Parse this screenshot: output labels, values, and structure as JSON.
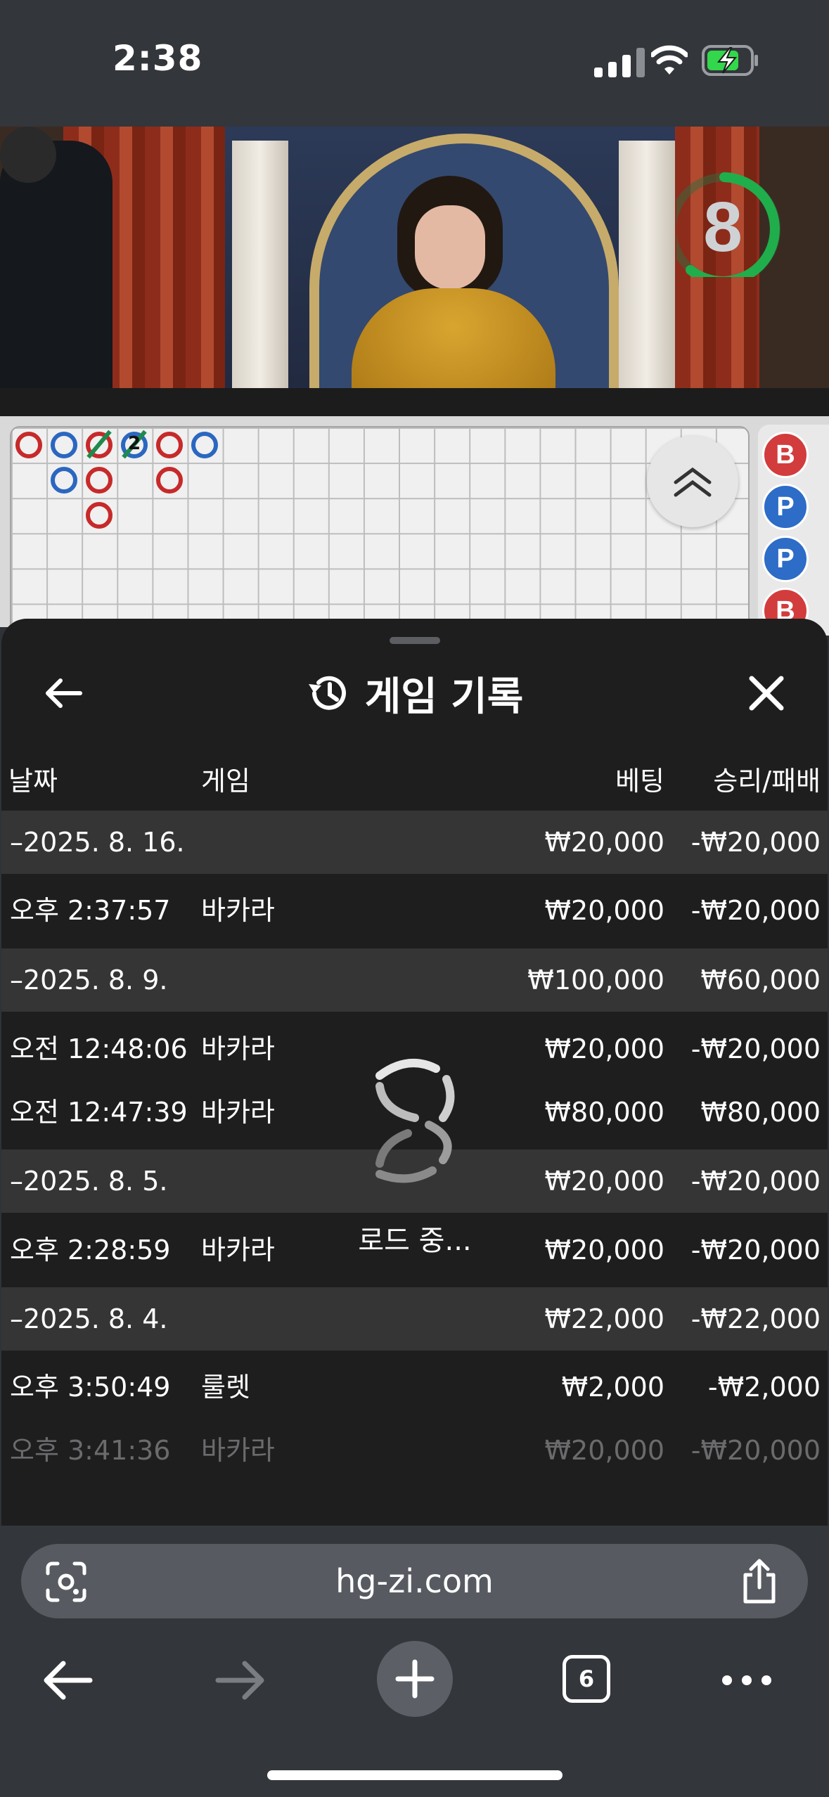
{
  "status_bar": {
    "time": "2:38"
  },
  "live_video": {
    "countdown": "8",
    "countdown_color": "#1fae4b"
  },
  "roadmap": {
    "tie_count": "2",
    "side_beads": [
      "B",
      "P",
      "P",
      "B"
    ]
  },
  "sheet": {
    "title": "게임 기록",
    "columns": {
      "date": "날짜",
      "game": "게임",
      "bet": "베팅",
      "result": "승리/패배"
    },
    "rows": [
      {
        "kind": "day",
        "date": "–2025. 8. 16.",
        "game": "",
        "bet": "₩20,000",
        "result": "-₩20,000"
      },
      {
        "kind": "game",
        "date": "오후 2:37:57",
        "game": "바카라",
        "bet": "₩20,000",
        "result": "-₩20,000"
      },
      {
        "kind": "day",
        "date": "–2025. 8. 9.",
        "game": "",
        "bet": "₩100,000",
        "result": "₩60,000"
      },
      {
        "kind": "game",
        "date": "오전 12:48:06",
        "game": "바카라",
        "bet": "₩20,000",
        "result": "-₩20,000"
      },
      {
        "kind": "game",
        "date": "오전 12:47:39",
        "game": "바카라",
        "bet": "₩80,000",
        "result": "₩80,000"
      },
      {
        "kind": "day",
        "date": "–2025. 8. 5.",
        "game": "",
        "bet": "₩20,000",
        "result": "-₩20,000"
      },
      {
        "kind": "game",
        "date": "오후 2:28:59",
        "game": "바카라",
        "bet": "₩20,000",
        "result": "-₩20,000"
      },
      {
        "kind": "day",
        "date": "–2025. 8. 4.",
        "game": "",
        "bet": "₩22,000",
        "result": "-₩22,000"
      },
      {
        "kind": "game",
        "date": "오후 3:50:49",
        "game": "룰렛",
        "bet": "₩2,000",
        "result": "-₩2,000"
      },
      {
        "kind": "game",
        "date": "오후 3:41:36",
        "game": "바카라",
        "bet": "₩20,000",
        "result": "-₩20,000"
      }
    ],
    "loading_text": "로드 중..."
  },
  "browser": {
    "url": "hg-zi.com",
    "tab_count": "6"
  }
}
